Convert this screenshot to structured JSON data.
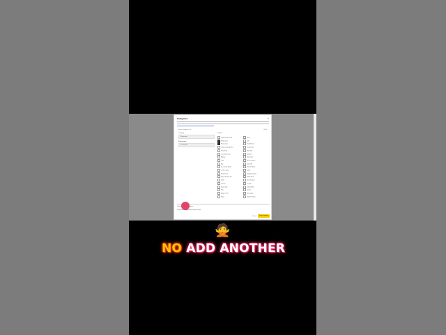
{
  "dialog": {
    "title": "Categories",
    "close_icon": "×",
    "count_text": "Select categories (3)",
    "clear_label": "Clear",
    "left": {
      "label": "Category",
      "primary_chip": "Restaurant",
      "sub_label": "Subcategory",
      "secondary_chip": "Pizza place"
    },
    "right_label": "Popular",
    "items_col1": [
      "Shopping & Retail",
      "Restaurant",
      "Pizza place",
      "Pasta & Noodle Bar",
      "Fast Food",
      "Local Business",
      "Bakery",
      "Café",
      "Bar",
      "Ice Cream Shop",
      "Coffee Shop",
      "Food Truck",
      "Italian Restaurant",
      "Diner",
      "Caterer",
      "Sports Bar",
      "Pub",
      "Burger Joint",
      "Hotel"
    ],
    "items_col2": [
      "Bistro",
      "Deli",
      "Food Stand",
      "Steakhouse",
      "Wine Bar",
      "Brewery",
      "Tea Room",
      "Grocery Store",
      "Juice Bar",
      "Dessert Shop",
      "Buffet",
      "Sandwich Shop",
      "Bagel Shop",
      "Beer Garden",
      "Lounge",
      "Cocktail Bar",
      "Tavern",
      "Gastropub",
      "Noodle House"
    ],
    "footer_line1": "Choose up to 3 categories",
    "footer_line2": "Categories help people find your Page",
    "cancel_label": "Cancel",
    "save_label": "Save changes"
  },
  "overlay": {
    "emoji": "🙅",
    "caption_no": "NO",
    "caption_rest": "ADD ANOTHER"
  },
  "colors": {
    "caption_yellow": "#ffc500",
    "caption_glow": "#ff2d68",
    "save_button": "#f5d000",
    "cursor_dot": "#e0315a"
  }
}
